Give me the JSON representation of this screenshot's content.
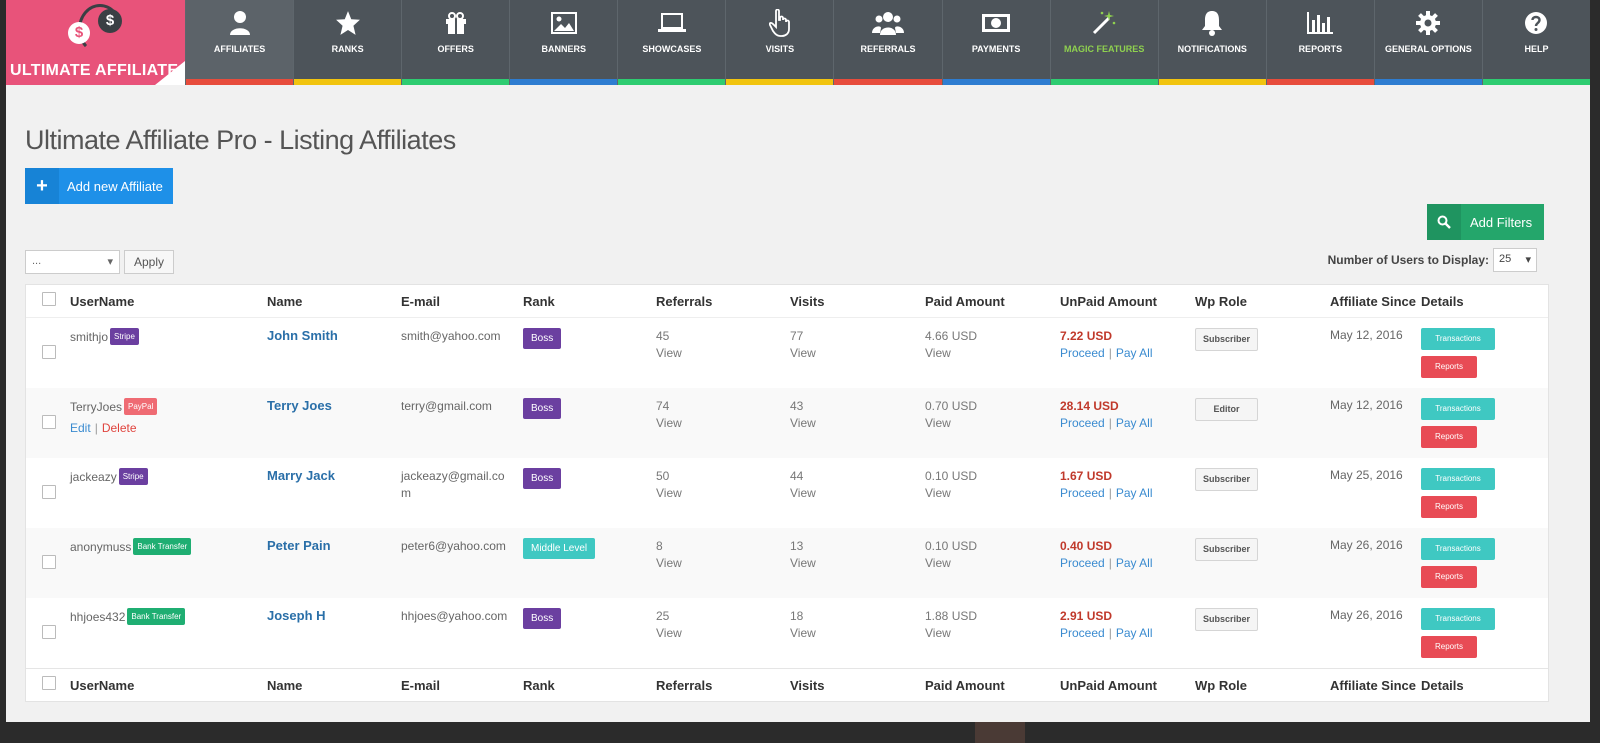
{
  "brand": {
    "name": "ULTIMATE AFFILIATE",
    "coin": "$"
  },
  "nav": [
    {
      "label": "Affiliates",
      "icon": "user-icon",
      "stripe": "#e74c3c",
      "active": true
    },
    {
      "label": "Ranks",
      "icon": "star-icon",
      "stripe": "#f1c40f"
    },
    {
      "label": "Offers",
      "icon": "gift-icon",
      "stripe": "#2ecc71"
    },
    {
      "label": "Banners",
      "icon": "image-icon",
      "stripe": "#2e7dd1"
    },
    {
      "label": "Showcases",
      "icon": "laptop-icon",
      "stripe": "#2ecc71"
    },
    {
      "label": "Visits",
      "icon": "pointer-icon",
      "stripe": "#f1c40f"
    },
    {
      "label": "Referrals",
      "icon": "users-icon",
      "stripe": "#e74c3c"
    },
    {
      "label": "Payments",
      "icon": "money-icon",
      "stripe": "#2e7dd1"
    },
    {
      "label": "Magic Features",
      "icon": "magic-wand-icon",
      "stripe": "#2ecc71"
    },
    {
      "label": "Notifications",
      "icon": "bell-icon",
      "stripe": "#f1c40f"
    },
    {
      "label": "Reports",
      "icon": "bar-chart-icon",
      "stripe": "#e74c3c"
    },
    {
      "label": "General Options",
      "icon": "gear-icon",
      "stripe": "#2e7dd1"
    },
    {
      "label": "Help",
      "icon": "question-icon",
      "stripe": "#2ecc71"
    }
  ],
  "page": {
    "title": "Ultimate Affiliate Pro - Listing Affiliates",
    "add_button": "Add new Affiliate",
    "filter_button": "Add Filters",
    "bulk_select": "...",
    "apply": "Apply",
    "users_display_label": "Number of Users to Display:",
    "users_display_value": "25"
  },
  "columns": [
    "UserName",
    "Name",
    "E-mail",
    "Rank",
    "Referrals",
    "Visits",
    "Paid Amount",
    "UnPaid Amount",
    "Wp Role",
    "Affiliate Since",
    "Details"
  ],
  "labels": {
    "view": "View",
    "proceed": "Proceed",
    "pay_all": "Pay All",
    "transactions": "Transactions",
    "reports": "Reports",
    "edit": "Edit",
    "delete": "Delete",
    "sep": "|"
  },
  "rows": [
    {
      "username": "smithjo",
      "method": "Stripe",
      "method_color": "#6b3fa0",
      "name": "John Smith",
      "email": "smith@yahoo.com",
      "rank": "Boss",
      "rank_color": "#6b3fa0",
      "referrals": "45",
      "visits": "77",
      "paid": "4.66 USD",
      "unpaid": "7.22 USD",
      "role": "Subscriber",
      "since": "May 12, 2016",
      "show_actions": false
    },
    {
      "username": "TerryJoes",
      "method": "PayPal",
      "method_color": "#ef6b73",
      "name": "Terry Joes",
      "email": "terry@gmail.com",
      "rank": "Boss",
      "rank_color": "#6b3fa0",
      "referrals": "74",
      "visits": "43",
      "paid": "0.70 USD",
      "unpaid": "28.14 USD",
      "role": "Editor",
      "since": "May 12, 2016",
      "show_actions": true
    },
    {
      "username": "jackeazy",
      "method": "Stripe",
      "method_color": "#6b3fa0",
      "name": "Marry Jack",
      "email": "jackeazy@gmail.com",
      "rank": "Boss",
      "rank_color": "#6b3fa0",
      "referrals": "50",
      "visits": "44",
      "paid": "0.10 USD",
      "unpaid": "1.67 USD",
      "role": "Subscriber",
      "since": "May 25, 2016",
      "show_actions": false
    },
    {
      "username": "anonymuss",
      "method": "Bank Transfer",
      "method_color": "#1fae72",
      "name": "Peter Pain",
      "email": "peter6@yahoo.com",
      "rank": "Middle Level",
      "rank_color": "#3fc8c2",
      "referrals": "8",
      "visits": "13",
      "paid": "0.10 USD",
      "unpaid": "0.40 USD",
      "role": "Subscriber",
      "since": "May 26, 2016",
      "show_actions": false
    },
    {
      "username": "hhjoes432",
      "method": "Bank Transfer",
      "method_color": "#1fae72",
      "name": "Joseph H",
      "email": "hhjoes@yahoo.com",
      "rank": "Boss",
      "rank_color": "#6b3fa0",
      "referrals": "25",
      "visits": "18",
      "paid": "1.88 USD",
      "unpaid": "2.91 USD",
      "role": "Subscriber",
      "since": "May 26, 2016",
      "show_actions": false
    }
  ]
}
